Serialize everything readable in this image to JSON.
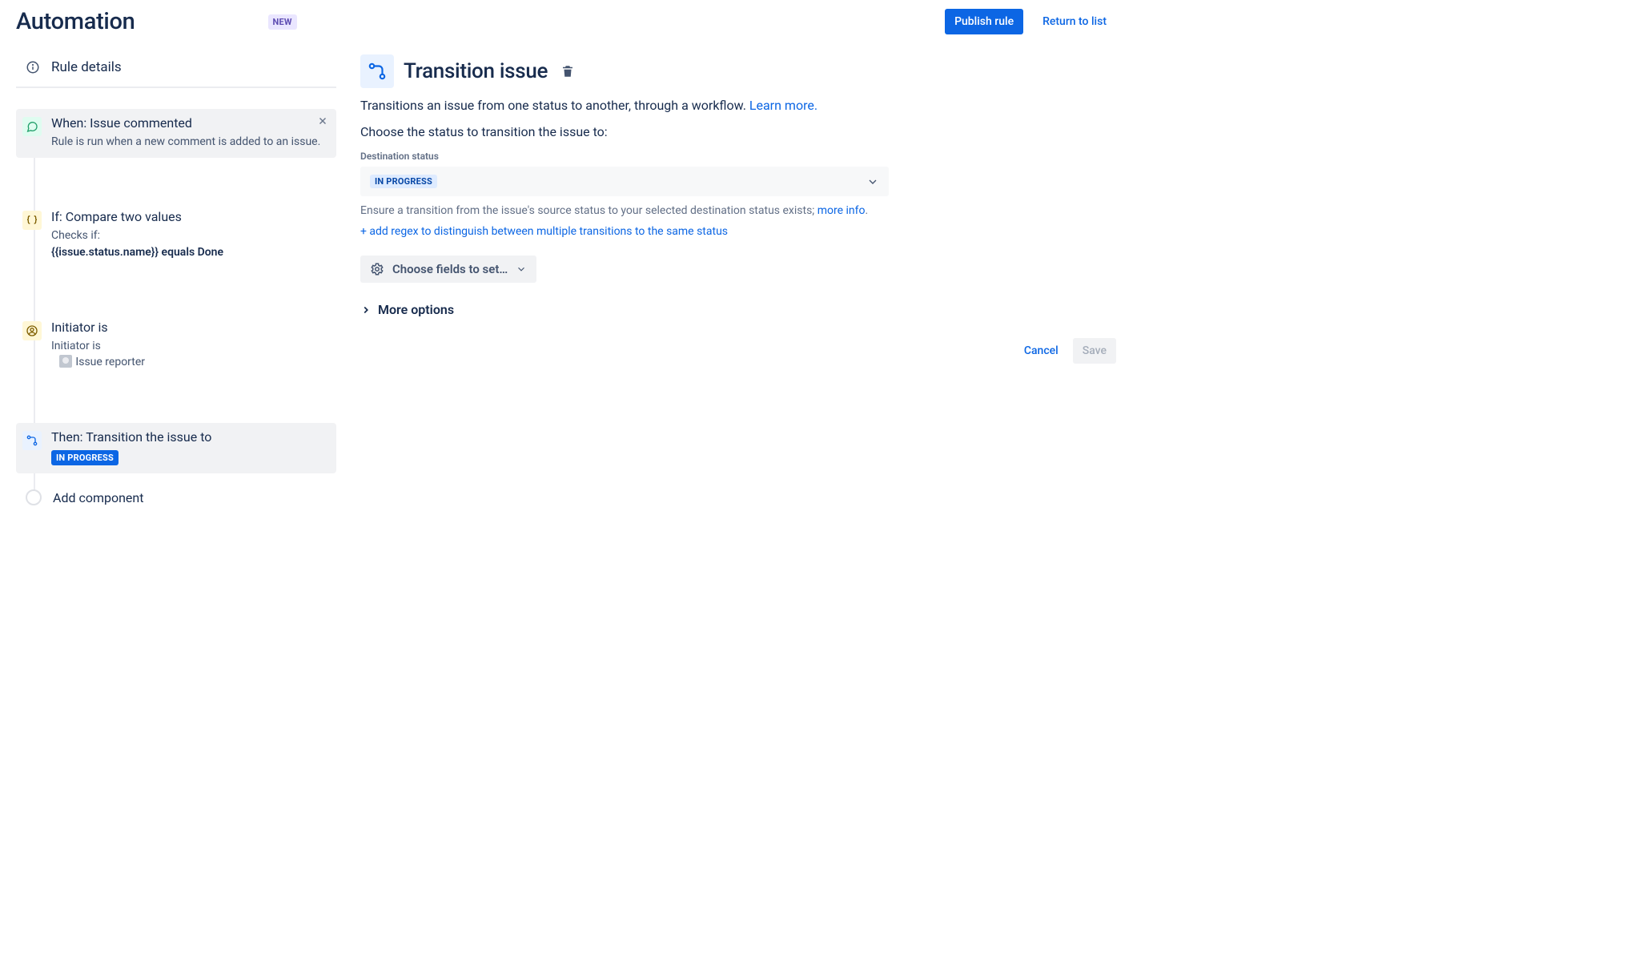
{
  "header": {
    "title": "Automation",
    "new_badge": "NEW",
    "publish_label": "Publish rule",
    "return_label": "Return to list"
  },
  "rule_details": {
    "label": "Rule details"
  },
  "chain": {
    "trigger": {
      "title": "When: Issue commented",
      "desc": "Rule is run when a new comment is added to an issue."
    },
    "condition1": {
      "title": "If: Compare two values",
      "desc_prefix": "Checks if:",
      "desc_strong": "{{issue.status.name}} equals Done"
    },
    "condition2": {
      "title": "Initiator is",
      "desc_prefix": "Initiator is",
      "desc_value": "Issue reporter"
    },
    "action": {
      "title": "Then: Transition the issue to",
      "status": "IN PROGRESS"
    },
    "add_component": "Add component"
  },
  "main": {
    "title": "Transition issue",
    "description_text": "Transitions an issue from one status to another, through a workflow. ",
    "learn_more": "Learn more.",
    "choose_status_label": "Choose the status to transition the issue to:",
    "dest_status_label": "Destination status",
    "dest_status_value": "IN PROGRESS",
    "helper_text_pre": "Ensure a transition from the issue's source status to your selected destination status exists; ",
    "helper_text_link": "more info",
    "add_regex": "+ add regex to distinguish between multiple transitions to the same status",
    "choose_fields_label": "Choose fields to set…",
    "more_options": "More options",
    "cancel_label": "Cancel",
    "save_label": "Save"
  }
}
